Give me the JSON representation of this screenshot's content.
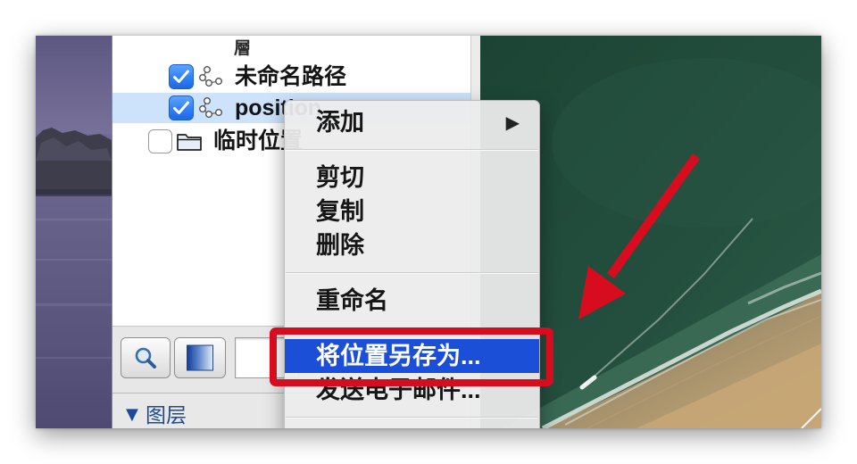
{
  "colors": {
    "checkbox_blue": "#2f80f7",
    "selection": "#cde2fb",
    "menu_highlight": "#1b4fd8",
    "annotation_red": "#d80c1f"
  },
  "sidebar": {
    "header_fragment": "層",
    "places": [
      {
        "label": "未命名路径",
        "checked": true,
        "selected": false,
        "icon": "path-icon"
      },
      {
        "label": "position",
        "checked": true,
        "selected": true,
        "icon": "path-icon"
      },
      {
        "label": "临时位置",
        "checked": false,
        "selected": false,
        "icon": "folder-icon"
      }
    ],
    "toolbar": {
      "search_button_icon": "magnifier-icon",
      "panel_button_icon": "panel-toggle-icon",
      "search_field_value": ""
    },
    "layers_section": {
      "disclosure": "▼",
      "label": "图层"
    }
  },
  "context_menu": {
    "groups": [
      [
        {
          "label": "添加",
          "submenu_indicator": "▶"
        }
      ],
      [
        {
          "label": "剪切"
        },
        {
          "label": "复制"
        },
        {
          "label": "删除"
        }
      ],
      [
        {
          "label": "重命名"
        }
      ],
      [
        {
          "label": "将位置另存为...",
          "highlighted": true
        },
        {
          "label": "发送电子邮件..."
        }
      ]
    ]
  },
  "annotations": {
    "arrow_icon": "arrow-down-left-icon",
    "box_icon": "highlight-box-icon"
  }
}
